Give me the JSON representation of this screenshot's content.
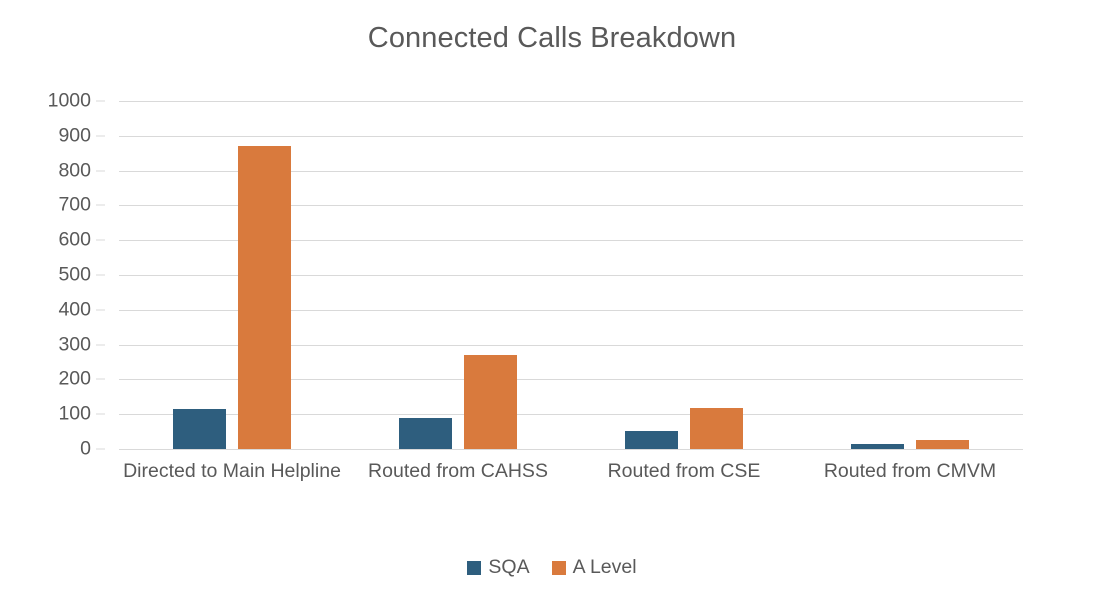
{
  "chart_data": {
    "type": "bar",
    "title": "Connected Calls Breakdown",
    "xlabel": "",
    "ylabel": "",
    "categories": [
      "Directed to Main Helpline",
      "Routed from CAHSS",
      "Routed from CSE",
      "Routed from CMVM"
    ],
    "series": [
      {
        "name": "SQA",
        "color": "#2E5E7E",
        "values": [
          115,
          89,
          53,
          15
        ]
      },
      {
        "name": "A Level",
        "color": "#D97A3D",
        "values": [
          872,
          270,
          117,
          25
        ]
      }
    ],
    "ylim": [
      0,
      1000
    ],
    "ytick_step": 100,
    "yticks": [
      0,
      100,
      200,
      300,
      400,
      500,
      600,
      700,
      800,
      900,
      1000
    ],
    "ytick_labels": [
      "0",
      "100",
      "200",
      "300",
      "400",
      "500",
      "600",
      "700",
      "800",
      "900",
      "1000"
    ],
    "grid": true,
    "grid_axis": "y",
    "grid_color": "#d9d9d9",
    "legend": true,
    "legend_position": "bottom",
    "legend_entries": [
      "SQA",
      "A Level"
    ],
    "background_color": "#ffffff",
    "text_color": "#595959"
  }
}
